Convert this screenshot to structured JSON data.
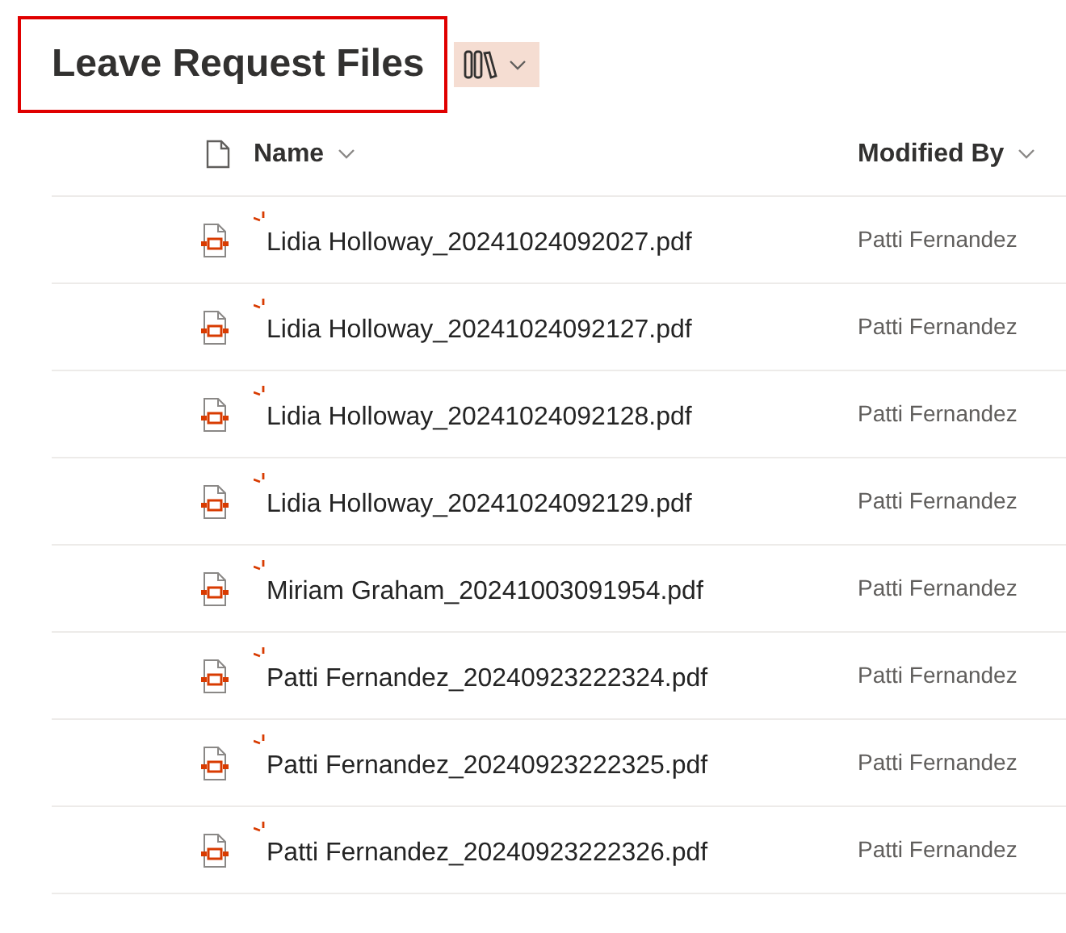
{
  "title": "Leave Request Files",
  "title_highlighted": true,
  "columns": [
    {
      "kind": "type"
    },
    {
      "kind": "name",
      "label": "Name"
    },
    {
      "kind": "modified_by",
      "label": "Modified By"
    }
  ],
  "files": [
    {
      "name": "Lidia Holloway_20241024092027.pdf",
      "modified_by": "Patti Fernandez",
      "new": true
    },
    {
      "name": "Lidia Holloway_20241024092127.pdf",
      "modified_by": "Patti Fernandez",
      "new": true
    },
    {
      "name": "Lidia Holloway_20241024092128.pdf",
      "modified_by": "Patti Fernandez",
      "new": true
    },
    {
      "name": "Lidia Holloway_20241024092129.pdf",
      "modified_by": "Patti Fernandez",
      "new": true
    },
    {
      "name": "Miriam Graham_20241003091954.pdf",
      "modified_by": "Patti Fernandez",
      "new": true
    },
    {
      "name": "Patti Fernandez_20240923222324.pdf",
      "modified_by": "Patti Fernandez",
      "new": true
    },
    {
      "name": "Patti Fernandez_20240923222325.pdf",
      "modified_by": "Patti Fernandez",
      "new": true
    },
    {
      "name": "Patti Fernandez_20240923222326.pdf",
      "modified_by": "Patti Fernandez",
      "new": true
    }
  ]
}
